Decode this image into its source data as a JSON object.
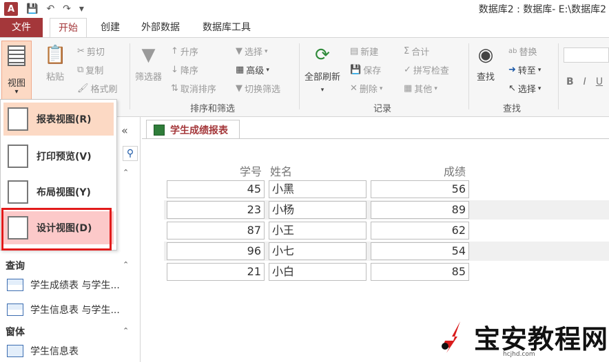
{
  "app": {
    "logo": "A",
    "window_title": "数据库2 : 数据库- E:\\数据库2"
  },
  "tabs": {
    "file": "文件",
    "home": "开始",
    "create": "创建",
    "external": "外部数据",
    "dbtools": "数据库工具"
  },
  "ribbon": {
    "view": {
      "label": "视图"
    },
    "clipboard": {
      "paste": "粘贴",
      "cut": "剪切",
      "copy": "复制",
      "format_painter": "格式刷"
    },
    "sort_filter": {
      "filter": "筛选器",
      "ascending": "升序",
      "descending": "降序",
      "remove_sort": "取消排序",
      "selection": "选择",
      "advanced": "高级",
      "toggle_filter": "切换筛选",
      "group_label": "排序和筛选"
    },
    "records": {
      "refresh_all": "全部刷新",
      "new": "新建",
      "save": "保存",
      "delete": "删除",
      "totals": "合计",
      "spelling": "拼写检查",
      "more": "其他",
      "group_label": "记录"
    },
    "find": {
      "find": "查找",
      "replace": "替换",
      "goto": "转至",
      "select": "选择",
      "group_label": "查找"
    },
    "font": {
      "bold": "B",
      "italic": "I",
      "underline": "U"
    }
  },
  "view_menu": {
    "items": [
      {
        "label": "报表视图(R)"
      },
      {
        "label": "打印预览(V)"
      },
      {
        "label": "布局视图(Y)"
      },
      {
        "label": "设计视图(D)"
      }
    ]
  },
  "nav": {
    "collapse": "«",
    "sections": [
      {
        "title": "查询",
        "items": [
          "学生成绩表 与学生...",
          "学生信息表 与学生..."
        ]
      },
      {
        "title": "窗体",
        "items": [
          "学生信息表"
        ]
      }
    ]
  },
  "document": {
    "tab_title": "学生成绩报表",
    "columns": [
      "学号",
      "姓名",
      "成绩"
    ],
    "rows": [
      {
        "id": "45",
        "name": "小黑",
        "score": "56"
      },
      {
        "id": "23",
        "name": "小杨",
        "score": "89"
      },
      {
        "id": "87",
        "name": "小王",
        "score": "62"
      },
      {
        "id": "96",
        "name": "小七",
        "score": "54"
      },
      {
        "id": "21",
        "name": "小白",
        "score": "85"
      }
    ]
  },
  "watermark": {
    "text": "宝安教程网",
    "url": "hcjhd.com"
  },
  "colors": {
    "accent": "#a4373a",
    "highlight": "#fcd9c4",
    "red_frame": "#e21a1a"
  }
}
